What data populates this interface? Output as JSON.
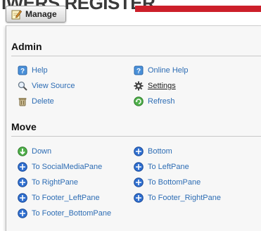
{
  "background": {
    "title_fragment": "IWERS   REGISTER",
    "accent_color": "#cc1f2a"
  },
  "manage_button": {
    "label": "Manage",
    "icon": "pencil-note-icon"
  },
  "admin": {
    "title": "Admin",
    "items": [
      {
        "label": "Help",
        "icon": "help-icon"
      },
      {
        "label": "Online Help",
        "icon": "help-icon"
      },
      {
        "label": "View Source",
        "icon": "magnifier-icon"
      },
      {
        "label": "Settings",
        "icon": "gear-icon"
      },
      {
        "label": "Delete",
        "icon": "trash-icon"
      },
      {
        "label": "Refresh",
        "icon": "refresh-icon"
      }
    ]
  },
  "move": {
    "title": "Move",
    "items": [
      {
        "label": "Down",
        "icon": "arrow-down-green-icon"
      },
      {
        "label": "Bottom",
        "icon": "move-blue-icon"
      },
      {
        "label": "To SocialMediaPane",
        "icon": "move-blue-icon"
      },
      {
        "label": "To LeftPane",
        "icon": "move-blue-icon"
      },
      {
        "label": "To RightPane",
        "icon": "move-blue-icon"
      },
      {
        "label": "To BottomPane",
        "icon": "move-blue-icon"
      },
      {
        "label": "To Footer_LeftPane",
        "icon": "move-blue-icon"
      },
      {
        "label": "To Footer_RightPane",
        "icon": "move-blue-icon"
      },
      {
        "label": "To Footer_BottomPane",
        "icon": "move-blue-icon"
      }
    ]
  },
  "colors": {
    "link": "#2e6db4",
    "panel_bg": "#f7f7f7"
  }
}
